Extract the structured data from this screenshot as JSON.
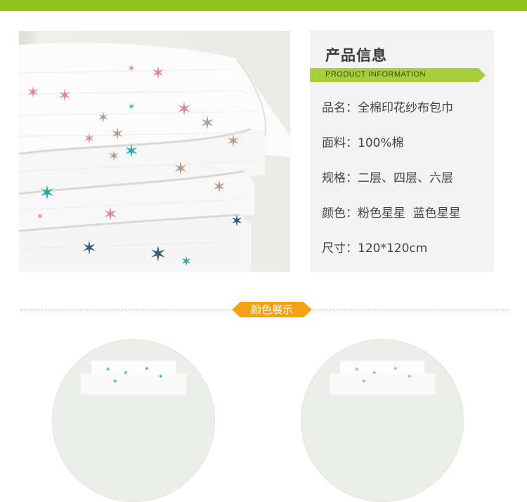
{
  "info": {
    "title": "产品信息",
    "subtitle": "PRODUCT INFORMATION",
    "specs": [
      {
        "label": "品名：",
        "value": "全棉印花纱布包巾"
      },
      {
        "label": "面料：",
        "value": "100%棉"
      },
      {
        "label": "规格：",
        "value": "二层、四层、六层"
      },
      {
        "label": "颜色：",
        "value": "粉色星星  蓝色星星"
      },
      {
        "label": "尺寸：",
        "value": "120*120cm"
      }
    ]
  },
  "section": {
    "title": "颜色展示"
  },
  "colors": {
    "top_bar": "#8dc21f",
    "ribbon": "#a6cf3a",
    "tag": "#f4a118",
    "pink_star": "#e8829e",
    "teal_star": "#2aa7a8",
    "navy_star": "#2c5a78",
    "beige_star": "#b59c8a"
  },
  "images": {
    "product_photo": "folded-muslin-blankets-with-star-print",
    "swatch_blue": "blue-star-blanket-swatch",
    "swatch_pink": "pink-star-blanket-swatch"
  }
}
